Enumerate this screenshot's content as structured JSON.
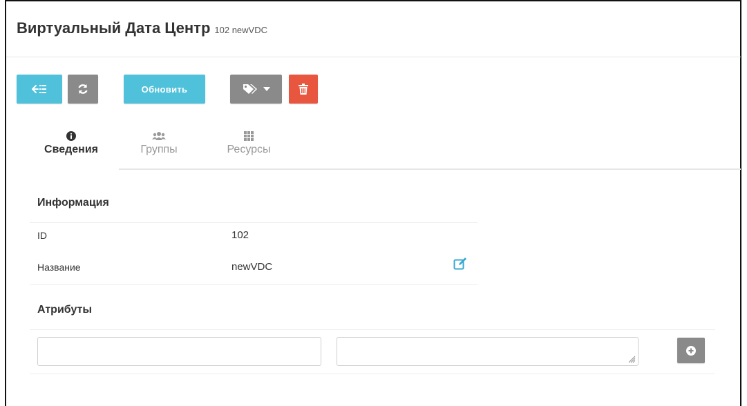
{
  "header": {
    "title": "Виртуальный Дата Центр",
    "subtitle": "102 newVDC"
  },
  "toolbar": {
    "back_icon": "arrow-left-list-icon",
    "refresh_icon": "refresh-icon",
    "update_label": "Обновить",
    "labels_icon": "tags-icon",
    "dropdown_icon": "caret-down-icon",
    "delete_icon": "trash-icon",
    "colors": {
      "info": "#4fc1da",
      "neutral": "#8a8a8a",
      "danger": "#e8563f"
    }
  },
  "tabs": [
    {
      "label": "Сведения",
      "icon": "info-circle-icon",
      "active": true
    },
    {
      "label": "Группы",
      "icon": "users-icon",
      "active": false
    },
    {
      "label": "Ресурсы",
      "icon": "grid-icon",
      "active": false
    }
  ],
  "info": {
    "title": "Информация",
    "rows": [
      {
        "label": "ID",
        "value": "102"
      },
      {
        "label": "Название",
        "value": "newVDC",
        "editable": true
      }
    ]
  },
  "attributes": {
    "title": "Атрибуты",
    "key_value": "",
    "value_value": "",
    "add_icon": "plus-circle-icon"
  }
}
